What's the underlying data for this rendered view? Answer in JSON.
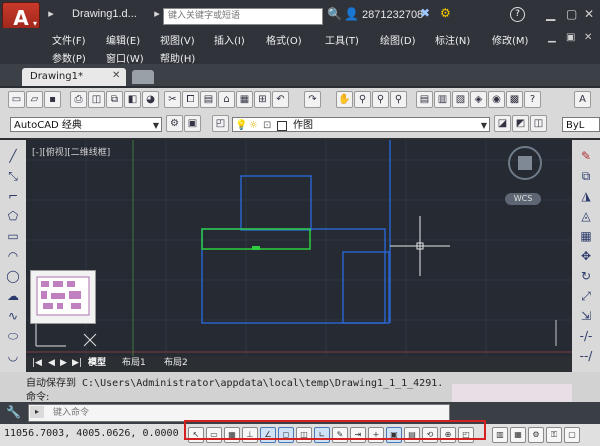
{
  "title_bar": {
    "document_title": "Drawing1.d...",
    "search_placeholder": "键入关键字或短语",
    "user_name": "2871232708",
    "help_label": "?"
  },
  "menu": {
    "row1": [
      "文件(F)",
      "编辑(E)",
      "视图(V)",
      "插入(I)",
      "格式(O)",
      "工具(T)",
      "绘图(D)",
      "标注(N)",
      "修改(M)"
    ],
    "row2": [
      "参数(P)",
      "窗口(W)",
      "帮助(H)"
    ]
  },
  "file_tab": {
    "label": "Drawing1*"
  },
  "toolbar2": {
    "workspace": "AutoCAD 经典",
    "layer": "作图",
    "bylayer": "ByL"
  },
  "canvas": {
    "viewport_label": "[-][俯视][二维线框]",
    "wcs_label": "WCS",
    "colors": {
      "background": "#252a33",
      "geometry": "#2a62c9",
      "highlight": "#2ecc40",
      "crosshair": "#e8e8e8"
    }
  },
  "layout_tabs": [
    "模型",
    "布局1",
    "布局2"
  ],
  "command": {
    "history": "自动保存到 C:\\Users\\Administrator\\appdata\\local\\temp\\Drawing1_1_1_4291.",
    "label": "命令:",
    "input_placeholder": "键入命令"
  },
  "status": {
    "coordinates": "11056.7003, 4005.0626, 0.0000"
  }
}
